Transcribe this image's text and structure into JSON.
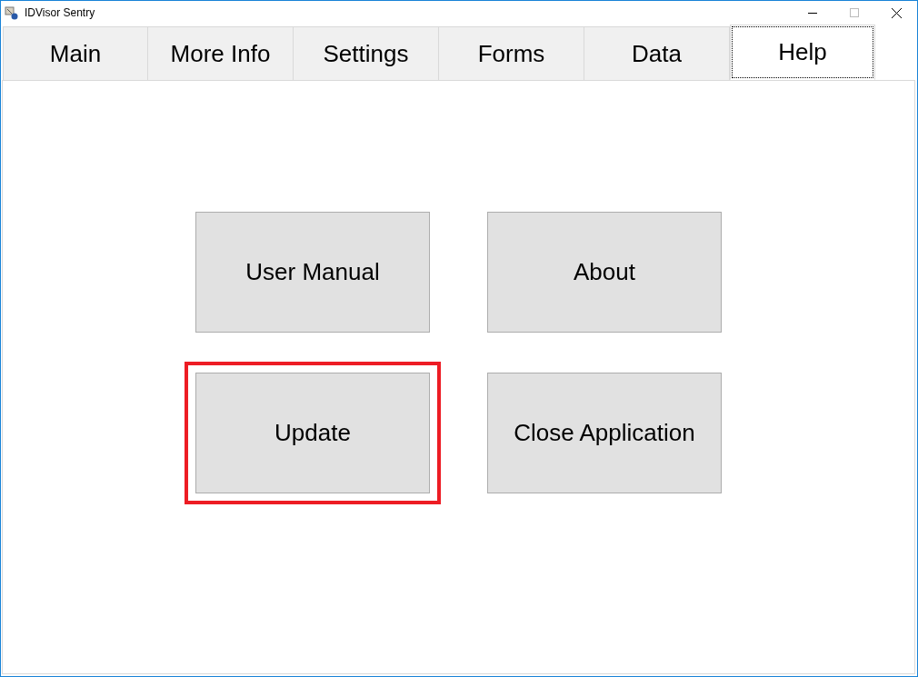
{
  "window": {
    "title": "IDVisor Sentry"
  },
  "tabs": [
    {
      "label": "Main",
      "selected": false
    },
    {
      "label": "More Info",
      "selected": false
    },
    {
      "label": "Settings",
      "selected": false
    },
    {
      "label": "Forms",
      "selected": false
    },
    {
      "label": "Data",
      "selected": false
    },
    {
      "label": "Help",
      "selected": true
    }
  ],
  "buttons": [
    {
      "label": "User Manual",
      "highlighted": false
    },
    {
      "label": "About",
      "highlighted": false
    },
    {
      "label": "Update",
      "highlighted": true
    },
    {
      "label": "Close Application",
      "highlighted": false
    }
  ]
}
